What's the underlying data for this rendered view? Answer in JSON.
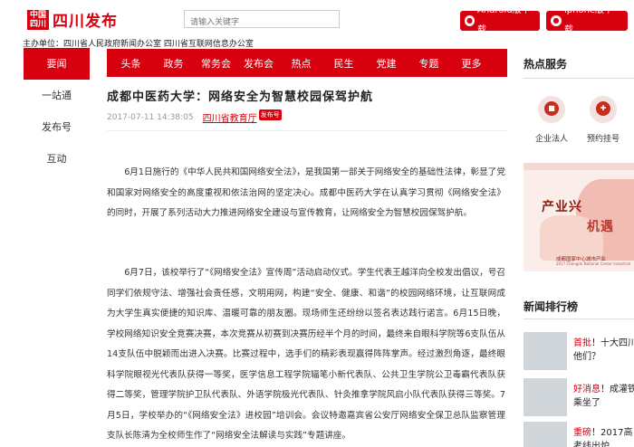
{
  "header": {
    "logo_mark": "中国四川",
    "logo_text": "四川发布",
    "search_placeholder": "请输入关键字",
    "android_label": "Android版下载",
    "iphone_label": "iphone版下载",
    "host_text": "主办单位：四川省人民政府新闻办公室 四川省互联网信息办公室"
  },
  "leftnav": {
    "items": [
      {
        "label": "要闻",
        "active": true
      },
      {
        "label": "一站通",
        "active": false
      },
      {
        "label": "发布号",
        "active": false
      },
      {
        "label": "互动",
        "active": false
      }
    ]
  },
  "mainnav": {
    "items": [
      "头条",
      "政务",
      "常务会",
      "发布会",
      "热点",
      "民生",
      "党建",
      "专题",
      "更多"
    ]
  },
  "article": {
    "title": "成都中医药大学：网络安全为智慧校园保驾护航",
    "time": "2017-07-11 14:38:05",
    "source": "四川省教育厅",
    "badge": "发布号",
    "para1": "6月1日施行的《中华人民共和国网络安全法》，是我国第一部关于网络安全的基础性法律，彰显了党和国家对网络安全的高度重视和依法治网的坚定决心。成都中医药大学在认真学习贯彻《网络安全法》的同时，开展了系列活动大力推进网络安全建设与宣传教育，让网络安全为智慧校园保驾护航。",
    "para2": "6月7日，该校举行了“《网络安全法》宣传周”活动启动仪式。学生代表王越洋向全校发出倡议，号召同学们依规守法、增强社会责任感，文明用网，构建“安全、健康、和谐”的校园网络环境，让互联网成为大学生真实便捷的知识库、温暖可靠的朋友圈。现场师生还纷纷以签名表达践行诺言。6月15日晚，学校网络知识安全竞赛决赛，本次竞赛从初赛到决赛历经半个月的时间，最终来自眼科学院等6支队伍从14支队伍中脱颖而出进入决赛。比赛过程中，选手们的精彩表现赢得阵阵掌声。经过激烈角逐，最终眼科学院眼视光代表队获得一等奖，医学信息工程学院辐笔小新代表队、公共卫生学院公卫毒霸代表队获得二等奖，管理学院护卫队代表队、外语学院极光代表队、针灸推拿学院风启小队代表队获得三等奖。7月5日，学校举办的“《网络安全法》进校园”培训会。会议特邀嘉宾省公安厅网络安全保卫总队监察管理支队长陈清为全校师生作了“网络安全法解读与实践”专题讲座。"
  },
  "sidebar": {
    "hot_title": "热点服务",
    "services": [
      {
        "label": "企业法人",
        "icon": "building-icon"
      },
      {
        "label": "预约挂号",
        "icon": "doctor-icon"
      }
    ],
    "banner": {
      "line1": "产业兴",
      "line2": "机遇",
      "line3": "成都国家中心城市产业",
      "line4": "2017 Chengdu National Center Industrial"
    },
    "rank_title": "新闻排行榜",
    "news": [
      {
        "tag": "首批",
        "text": "！十大四川他们？"
      },
      {
        "tag": "好消息",
        "text": "！成灌铁乘坐了"
      },
      {
        "tag": "重磅",
        "text": "！2017高考线出炉"
      }
    ]
  },
  "colors": {
    "brand_red": "#d7000f"
  }
}
